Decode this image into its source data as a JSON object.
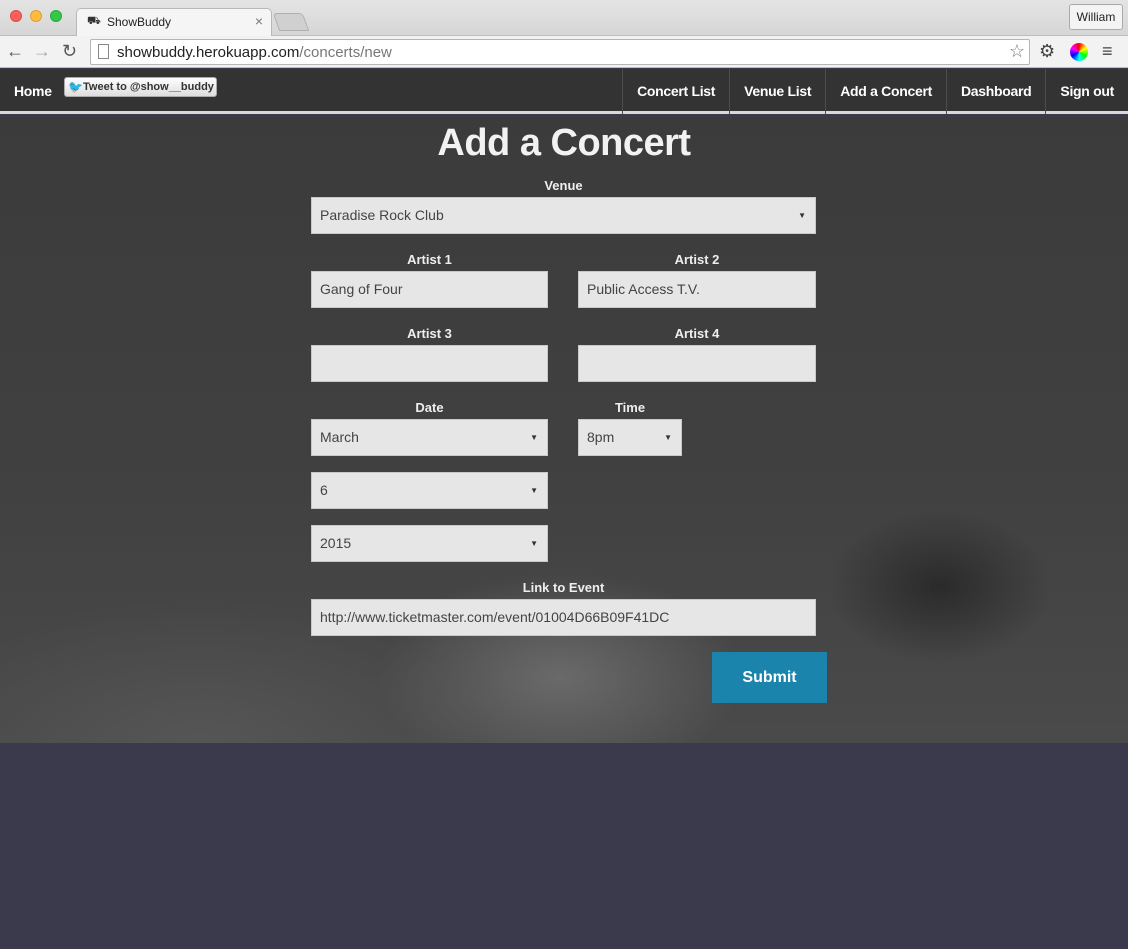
{
  "browser": {
    "tab_title": "ShowBuddy",
    "tab_close": "×",
    "profile_name": "William",
    "url_host": "showbuddy.herokuapp.com",
    "url_path": "/concerts/new"
  },
  "nav": {
    "home": "Home",
    "tweet_label": "Tweet to @show__buddy",
    "items": [
      "Concert List",
      "Venue List",
      "Add a Concert",
      "Dashboard",
      "Sign out"
    ]
  },
  "form": {
    "title": "Add a Concert",
    "venue_label": "Venue",
    "venue_value": "Paradise Rock Club",
    "artist1_label": "Artist 1",
    "artist1_value": "Gang of Four",
    "artist2_label": "Artist 2",
    "artist2_value": "Public Access T.V.",
    "artist3_label": "Artist 3",
    "artist3_value": "",
    "artist4_label": "Artist 4",
    "artist4_value": "",
    "date_label": "Date",
    "month_value": "March",
    "day_value": "6",
    "year_value": "2015",
    "time_label": "Time",
    "time_value": "8pm",
    "link_label": "Link to Event",
    "link_value": "http://www.ticketmaster.com/event/01004D66B09F41DC",
    "submit_label": "Submit"
  },
  "colors": {
    "accent": "#1a84ad",
    "navbar": "#333333"
  }
}
